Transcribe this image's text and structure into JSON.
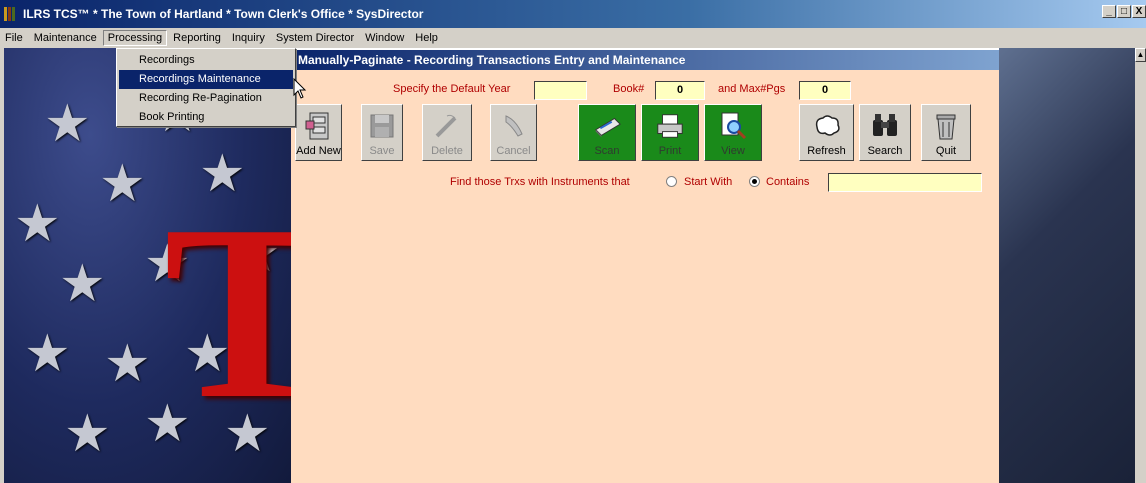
{
  "app": {
    "title": "ILRS TCS™ * The Town of Hartland * Town Clerk's Office * SysDirector",
    "window_controls": [
      "_",
      "□",
      "X"
    ]
  },
  "menubar": {
    "items": [
      "File",
      "Maintenance",
      "Processing",
      "Reporting",
      "Inquiry",
      "System Director",
      "Window",
      "Help"
    ],
    "open_item": "Processing"
  },
  "dropdown": {
    "items": [
      "Recordings",
      "Recordings Maintenance",
      "Recording Re-Pagination",
      "Book Printing"
    ],
    "highlighted": "Recordings Maintenance"
  },
  "background": {
    "letter": "T"
  },
  "child_window": {
    "title": "Manually-Paginate - Recording Transactions Entry and Maintenance",
    "default_year_label": "Specify the Default Year",
    "default_year_value": "",
    "book_label": "Book#",
    "book_value": "0",
    "max_pgs_label": "and Max#Pgs",
    "max_pgs_value": "0",
    "toolbar": [
      {
        "label": "Add New",
        "icon": "file-cabinet-icon",
        "enabled": true
      },
      {
        "label": "Save",
        "icon": "floppy-disk-icon",
        "enabled": false
      },
      {
        "label": "Delete",
        "icon": "delete-pen-icon",
        "enabled": false
      },
      {
        "label": "Cancel",
        "icon": "cancel-icon",
        "enabled": false
      },
      {
        "label": "Scan",
        "icon": "scanner-icon",
        "enabled": true
      },
      {
        "label": "Print",
        "icon": "printer-icon",
        "enabled": true
      },
      {
        "label": "View",
        "icon": "magnifier-icon",
        "enabled": true
      },
      {
        "label": "Refresh",
        "icon": "refresh-icon",
        "enabled": true
      },
      {
        "label": "Search",
        "icon": "binoculars-icon",
        "enabled": true
      },
      {
        "label": "Quit",
        "icon": "trash-can-icon",
        "enabled": true
      }
    ],
    "find_label": "Find those Trxs with Instruments that",
    "radio_start_with": "Start With",
    "radio_contains": "Contains",
    "radio_selected": "Contains",
    "find_value": ""
  },
  "colors": {
    "form_bg": "#ffdcc0",
    "label_red": "#b00000",
    "input_yellow": "#ffffc0",
    "green_button": "#1a8a1a",
    "titlebar": "#0a246a"
  }
}
